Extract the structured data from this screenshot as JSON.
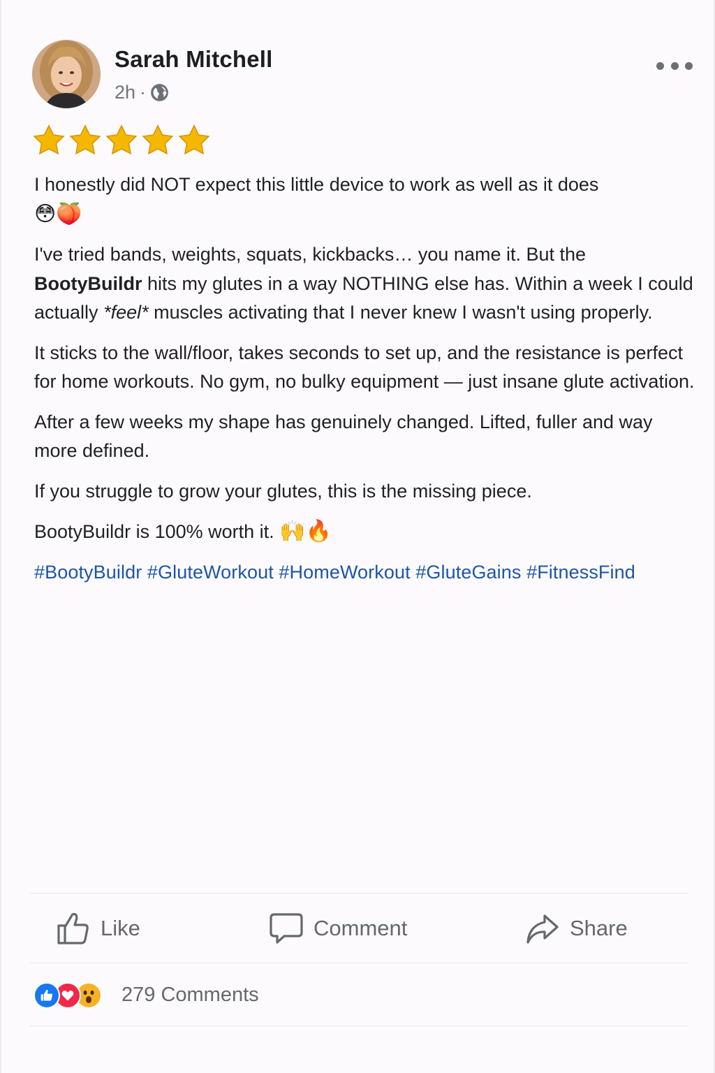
{
  "post": {
    "author": "Sarah Mitchell",
    "time": "2h",
    "separator": "·",
    "visibility_icon": "globe-icon",
    "rating": 5,
    "paragraphs": {
      "p1": "I honestly did NOT expect this little device to work as well as it does",
      "p1_emoji": "😳🍑",
      "p2_a": "I've tried bands, weights, squats, kickbacks… you name it. But the",
      "p2_brand": "BootyBuildr",
      "p2_b": "hits my glutes in a way NOTHING else has. Within a week I could actually",
      "p2_em": "*feel*",
      "p2_c": "muscles activating that I never knew I wasn't using properly.",
      "p3": "It sticks to the wall/floor, takes seconds to set up, and the resistance is perfect for home workouts. No gym, no bulky equipment — just insane glute activation.",
      "p4": "After a few weeks my shape has genuinely changed. Lifted, fuller and way more defined.",
      "p5": "If you struggle to grow your glutes, this is the missing piece.",
      "p6": "BootyBuildr is 100% worth it.",
      "p6_emoji": "🙌🔥"
    },
    "hashtags": [
      "#BootyBuildr",
      "#GluteWorkout",
      "#HomeWorkout",
      "#GluteGains",
      "#FitnessFind"
    ]
  },
  "actions": {
    "like": "Like",
    "comment": "Comment",
    "share": "Share"
  },
  "footer": {
    "reaction_icons": [
      "like-reaction-icon",
      "love-reaction-icon",
      "wow-reaction-icon"
    ],
    "comments": "279 Comments"
  },
  "colors": {
    "star": "#f5b800",
    "hashtag": "#1e55a8",
    "like_blue": "#1877f2",
    "love_red": "#f02849",
    "wow_yellow": "#f7b125"
  }
}
